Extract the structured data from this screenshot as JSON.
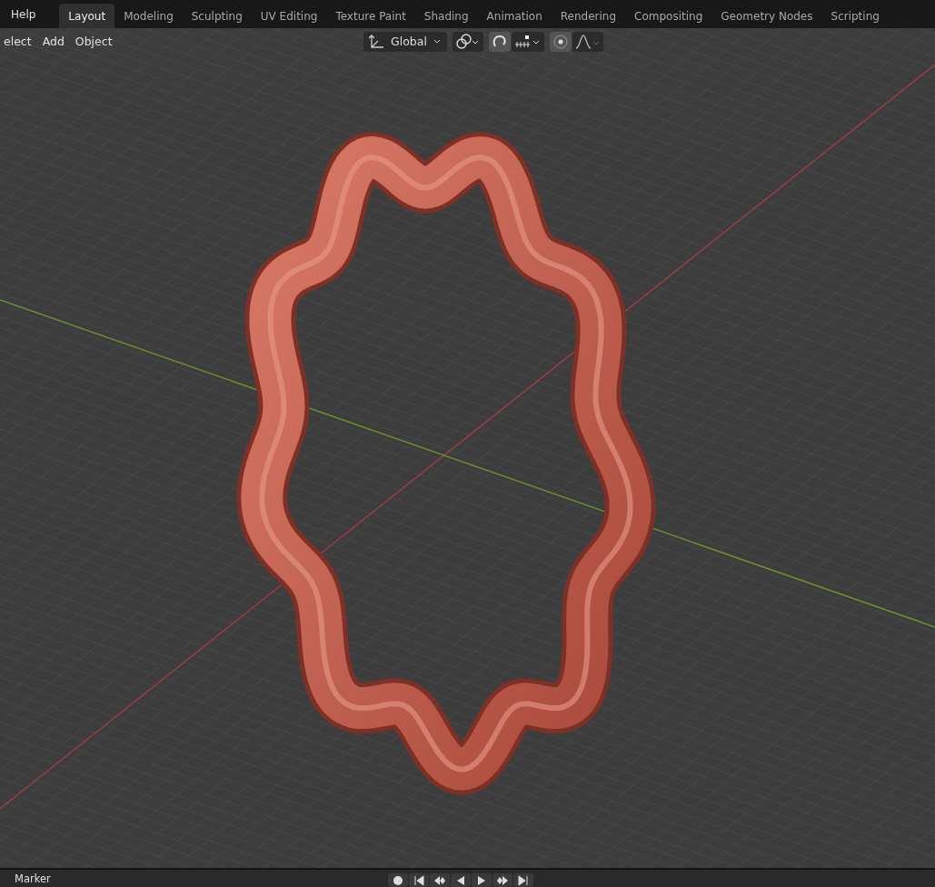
{
  "topbar": {
    "menu": "Help",
    "tabs": [
      {
        "label": "Layout",
        "selected": true
      },
      {
        "label": "Modeling",
        "selected": false
      },
      {
        "label": "Sculpting",
        "selected": false
      },
      {
        "label": "UV Editing",
        "selected": false
      },
      {
        "label": "Texture Paint",
        "selected": false
      },
      {
        "label": "Shading",
        "selected": false
      },
      {
        "label": "Animation",
        "selected": false
      },
      {
        "label": "Rendering",
        "selected": false
      },
      {
        "label": "Compositing",
        "selected": false
      },
      {
        "label": "Geometry Nodes",
        "selected": false
      },
      {
        "label": "Scripting",
        "selected": false
      }
    ]
  },
  "viewport_header": {
    "menus": [
      "elect",
      "Add",
      "Object"
    ],
    "transform_orientation": "Global",
    "snap": {
      "on": true
    },
    "proportional_editing": {
      "on": true
    }
  },
  "timeline": {
    "menu": "Marker"
  }
}
